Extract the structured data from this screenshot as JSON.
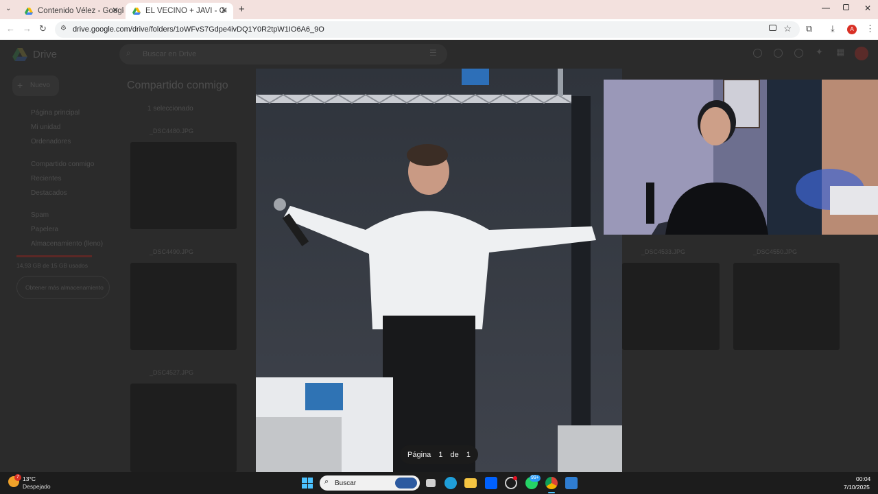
{
  "browser": {
    "tabs": [
      {
        "title": "Contenido Vélez - Google Drive",
        "active": false
      },
      {
        "title": "EL VECINO + JAVI - Google Drive",
        "active": true
      }
    ],
    "url": "drive.google.com/drive/folders/1oWFvS7Gdpe4ivDQ1Y0R2tpW1IO6A6_9O",
    "profile_initial": "A"
  },
  "drive": {
    "app_name": "Drive",
    "search_placeholder": "Buscar en Drive",
    "new_button": "Nuevo",
    "sidebar": [
      "Página principal",
      "Mi unidad",
      "Ordenadores",
      "Compartido conmigo",
      "Recientes",
      "Destacados",
      "Spam",
      "Papelera",
      "Almacenamiento (lleno)"
    ],
    "storage_text": "14,93 GB de 15 GB usados",
    "storage_button": "Obtener más almacenamiento",
    "heading": "Compartido conmigo",
    "selection_text": "1 seleccionado",
    "files": [
      "_DSC4480.JPG",
      "_DSC4490.JPG",
      "_DSC4527.JPG",
      "_DSC4533.JPG",
      "_DSC4550.JPG"
    ]
  },
  "viewer": {
    "page_label": "Página",
    "page_current": "1",
    "page_of": "de",
    "page_total": "1"
  },
  "taskbar": {
    "weather_temp": "13°C",
    "weather_desc": "Despejado",
    "weather_badge": "7",
    "search_placeholder": "Buscar",
    "whatsapp_badge": "99+",
    "time": "00:04",
    "date": "7/10/2025"
  },
  "colors": {
    "tabstrip": "#f3e1de",
    "drive_dim": "#2b2b2b",
    "taskbar": "#1c1c1c",
    "pager_bg": "#1b1b1b"
  }
}
